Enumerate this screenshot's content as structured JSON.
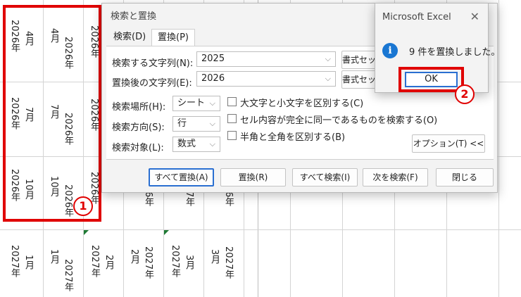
{
  "sheet": {
    "col1": [
      {
        "year": "2026年",
        "month": "4月"
      },
      {
        "year": "2026年",
        "month": "7月"
      },
      {
        "year": "2026年",
        "month": "10月"
      },
      {
        "year": "2027年",
        "month": "1月"
      }
    ],
    "col2": [
      {
        "month": "4月",
        "year": "2026年"
      },
      {
        "month": "7月",
        "year": "2026年"
      },
      {
        "month": "10月",
        "year": "2026年"
      },
      {
        "month": "1月",
        "year": "2027年"
      }
    ],
    "col3_top": [
      "2026年",
      "2026年",
      "2026年"
    ],
    "row4_rest": [
      {
        "year": "2027年",
        "month": "2月"
      },
      {
        "month": "2月",
        "year": "2027年"
      },
      {
        "year": "2027年",
        "month": "3月"
      },
      {
        "month": "3月",
        "year": "2027年"
      }
    ],
    "under_dialog": [
      "6年",
      "7年",
      "6年"
    ]
  },
  "annotations": {
    "badge1": "1",
    "badge2": "2"
  },
  "dialog": {
    "title": "検索と置換",
    "tabs": [
      "検索(D)",
      "置換(P)"
    ],
    "find_label": "検索する文字列(N):",
    "find_value": "2025",
    "replace_label": "置換後の文字列(E):",
    "replace_value": "2026",
    "format_btn": "書式セット",
    "within_label": "検索場所(H):",
    "within_value": "シート",
    "search_label": "検索方向(S):",
    "search_value": "行",
    "look_label": "検索対象(L):",
    "look_value": "数式",
    "opt_case": "大文字と小文字を区別する(C)",
    "opt_entire": "セル内容が完全に同一であるものを検索する(O)",
    "opt_width": "半角と全角を区別する(B)",
    "options_btn": "オプション(T) <<",
    "replace_all": "すべて置換(A)",
    "replace": "置換(R)",
    "find_all": "すべて検索(I)",
    "find_next": "次を検索(F)",
    "close": "閉じる"
  },
  "message": {
    "title": "Microsoft Excel",
    "text": "9 件を置換しました。",
    "ok": "OK",
    "icon": "info-icon"
  },
  "colors": {
    "accent": "#2a6fd1",
    "highlight": "#e00000",
    "info": "#1976d2"
  }
}
